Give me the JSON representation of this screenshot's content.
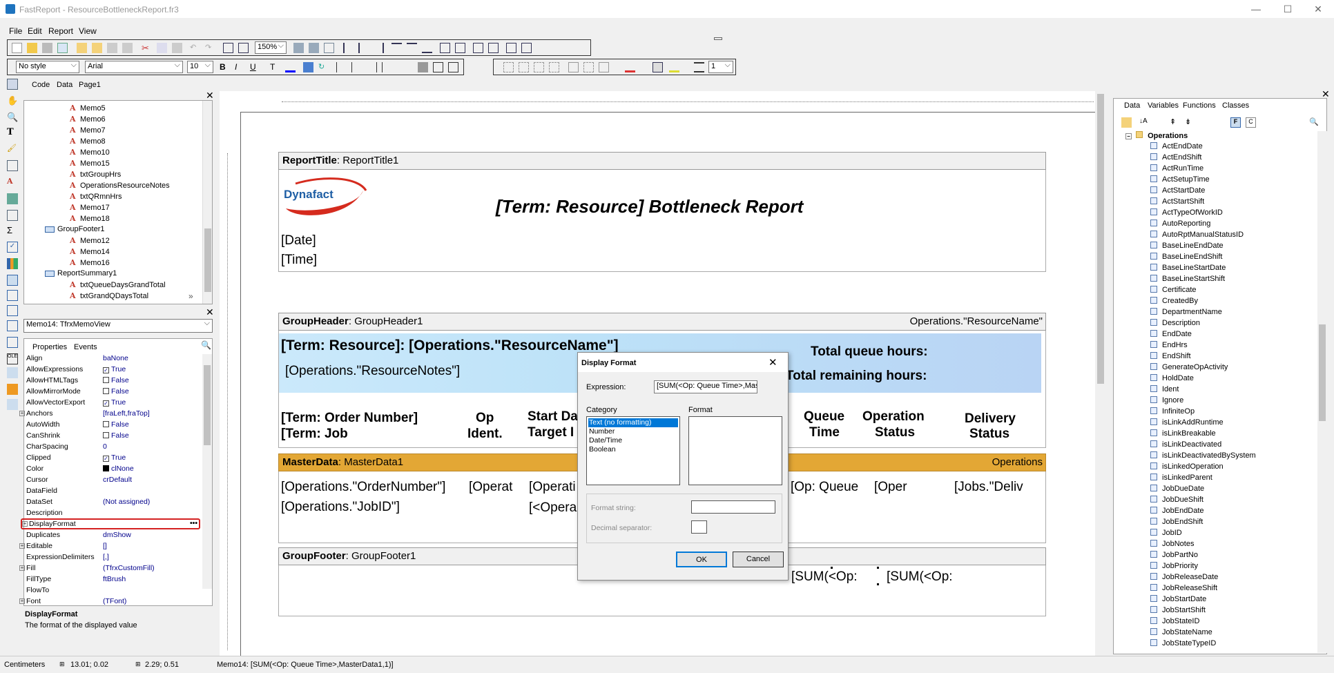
{
  "window": {
    "title": "FastReport - ResourceBottleneckReport.fr3"
  },
  "menu": [
    "File",
    "Edit",
    "Report",
    "View"
  ],
  "toolbar": {
    "zoom": "150%",
    "style": "No style",
    "font": "Arial",
    "size": "10",
    "frame_width": "1"
  },
  "designer_tabs": [
    "Code",
    "Data",
    "Page1"
  ],
  "tree": {
    "items": [
      {
        "label": "Memo5",
        "level": 3
      },
      {
        "label": "Memo6",
        "level": 3
      },
      {
        "label": "Memo7",
        "level": 3
      },
      {
        "label": "Memo8",
        "level": 3
      },
      {
        "label": "Memo10",
        "level": 3
      },
      {
        "label": "Memo15",
        "level": 3
      },
      {
        "label": "txtGroupHrs",
        "level": 3
      },
      {
        "label": "OperationsResourceNotes",
        "level": 3
      },
      {
        "label": "txtQRmnHrs",
        "level": 3
      },
      {
        "label": "Memo17",
        "level": 3
      },
      {
        "label": "Memo18",
        "level": 3
      },
      {
        "label": "GroupFooter1",
        "level": 2
      },
      {
        "label": "Memo12",
        "level": 3
      },
      {
        "label": "Memo14",
        "level": 3
      },
      {
        "label": "Memo16",
        "level": 3
      },
      {
        "label": "ReportSummary1",
        "level": 2
      },
      {
        "label": "txtQueueDaysGrandTotal",
        "level": 3
      },
      {
        "label": "txtGrandQDaysTotal",
        "level": 3
      }
    ]
  },
  "inspector": {
    "object": "Memo14: TfrxMemoView",
    "tabs": [
      "Properties",
      "Events"
    ],
    "rows": [
      {
        "name": "Align",
        "value": "baNone"
      },
      {
        "name": "AllowExpressions",
        "value": "True",
        "check": true
      },
      {
        "name": "AllowHTMLTags",
        "value": "False",
        "check": false
      },
      {
        "name": "AllowMirrorMode",
        "value": "False",
        "check": false
      },
      {
        "name": "AllowVectorExport",
        "value": "True",
        "check": true
      },
      {
        "name": "Anchors",
        "value": "[fraLeft,fraTop]",
        "expand": true
      },
      {
        "name": "AutoWidth",
        "value": "False",
        "check": false
      },
      {
        "name": "CanShrink",
        "value": "False",
        "check": false
      },
      {
        "name": "CharSpacing",
        "value": "0"
      },
      {
        "name": "Clipped",
        "value": "True",
        "check": true
      },
      {
        "name": "Color",
        "value": "clNone"
      },
      {
        "name": "Cursor",
        "value": "crDefault"
      },
      {
        "name": "DataField",
        "value": ""
      },
      {
        "name": "DataSet",
        "value": "(Not assigned)"
      },
      {
        "name": "Description",
        "value": ""
      },
      {
        "name": "DisplayFormat",
        "value": "",
        "expand": true,
        "selected": true
      },
      {
        "name": "Duplicates",
        "value": "dmShow"
      },
      {
        "name": "Editable",
        "value": "[]",
        "expand": true
      },
      {
        "name": "ExpressionDelimiters",
        "value": "[,]"
      },
      {
        "name": "Fill",
        "value": "(TfrxCustomFill)",
        "expand": true
      },
      {
        "name": "FillType",
        "value": "ftBrush"
      },
      {
        "name": "FlowTo",
        "value": ""
      },
      {
        "name": "Font",
        "value": "(TFont)",
        "expand": true
      }
    ],
    "help_title": "DisplayFormat",
    "help_text": "The format of the displayed value"
  },
  "report": {
    "title_band": {
      "label": "ReportTitle",
      "name": "ReportTitle1"
    },
    "logo_text": "Dynafact",
    "report_title": "[Term: Resource] Bottleneck Report",
    "date": "[Date]",
    "time": "[Time]",
    "group_header": {
      "label": "GroupHeader",
      "name": "GroupHeader1",
      "condition": "Operations.\"ResourceName\""
    },
    "resource_line": "[Term: Resource]: [Operations.\"ResourceName\"]",
    "resource_notes": "[Operations.\"ResourceNotes\"]",
    "total_queue": "Total queue hours:",
    "total_remaining": "Total remaining hours:",
    "col_order_1": "[Term: Order Number]",
    "col_order_2": "[Term: Job",
    "col_op_1": "Op",
    "col_op_2": "Ident.",
    "col_start_1": "Start Da",
    "col_start_2": "Target I",
    "col_queue_1": "Queue",
    "col_queue_2": "Time",
    "col_opstatus_1": "Operation",
    "col_opstatus_2": "Status",
    "col_delivery_1": "Delivery",
    "col_delivery_2": "Status",
    "master_data": {
      "label": "MasterData",
      "name": "MasterData1",
      "dataset": "Operations"
    },
    "md_order": "[Operations.\"OrderNumber\"]",
    "md_job": "[Operations.\"JobID\"]",
    "md_op": "[Operat",
    "md_start": "[Operati",
    "md_start2": "[<Opera",
    "md_queue": "[Op: Queue",
    "md_opstatus": "[Oper",
    "md_delivery": "[Jobs.\"Deliv",
    "group_footer": {
      "label": "GroupFooter",
      "name": "GroupFooter1"
    },
    "gf_sum1": "[SUM(<Op:",
    "gf_sum2": "[SUM(<Op:"
  },
  "dialog": {
    "title": "Display Format",
    "expression_label": "Expression:",
    "expression_value": "[SUM(<Op: Queue Time>,MasterD",
    "category_label": "Category",
    "categories": [
      "Text (no formatting)",
      "Number",
      "Date/Time",
      "Boolean"
    ],
    "format_label": "Format",
    "format_string_label": "Format string:",
    "decimal_sep_label": "Decimal separator:",
    "ok": "OK",
    "cancel": "Cancel"
  },
  "data_tree": {
    "tabs": [
      "Data",
      "Variables",
      "Functions",
      "Classes"
    ],
    "root": "Operations",
    "fields": [
      "ActEndDate",
      "ActEndShift",
      "ActRunTime",
      "ActSetupTime",
      "ActStartDate",
      "ActStartShift",
      "ActTypeOfWorkID",
      "AutoReporting",
      "AutoRptManualStatusID",
      "BaseLineEndDate",
      "BaseLineEndShift",
      "BaseLineStartDate",
      "BaseLineStartShift",
      "Certificate",
      "CreatedBy",
      "DepartmentName",
      "Description",
      "EndDate",
      "EndHrs",
      "EndShift",
      "GenerateOpActivity",
      "HoldDate",
      "Ident",
      "Ignore",
      "InfiniteOp",
      "isLinkAddRuntime",
      "isLinkBreakable",
      "isLinkDeactivated",
      "isLinkDeactivatedBySystem",
      "isLinkedOperation",
      "isLinkedParent",
      "JobDueDate",
      "JobDueShift",
      "JobEndDate",
      "JobEndShift",
      "JobID",
      "JobNotes",
      "JobPartNo",
      "JobPriority",
      "JobReleaseDate",
      "JobReleaseShift",
      "JobStartDate",
      "JobStartShift",
      "JobStateID",
      "JobStateName",
      "JobStateTypeID"
    ]
  },
  "status": {
    "units": "Centimeters",
    "position": "13.01; 0.02",
    "size": "2.29; 0.51",
    "info": "Memo14: [SUM(<Op: Queue Time>,MasterData1,1)]"
  }
}
